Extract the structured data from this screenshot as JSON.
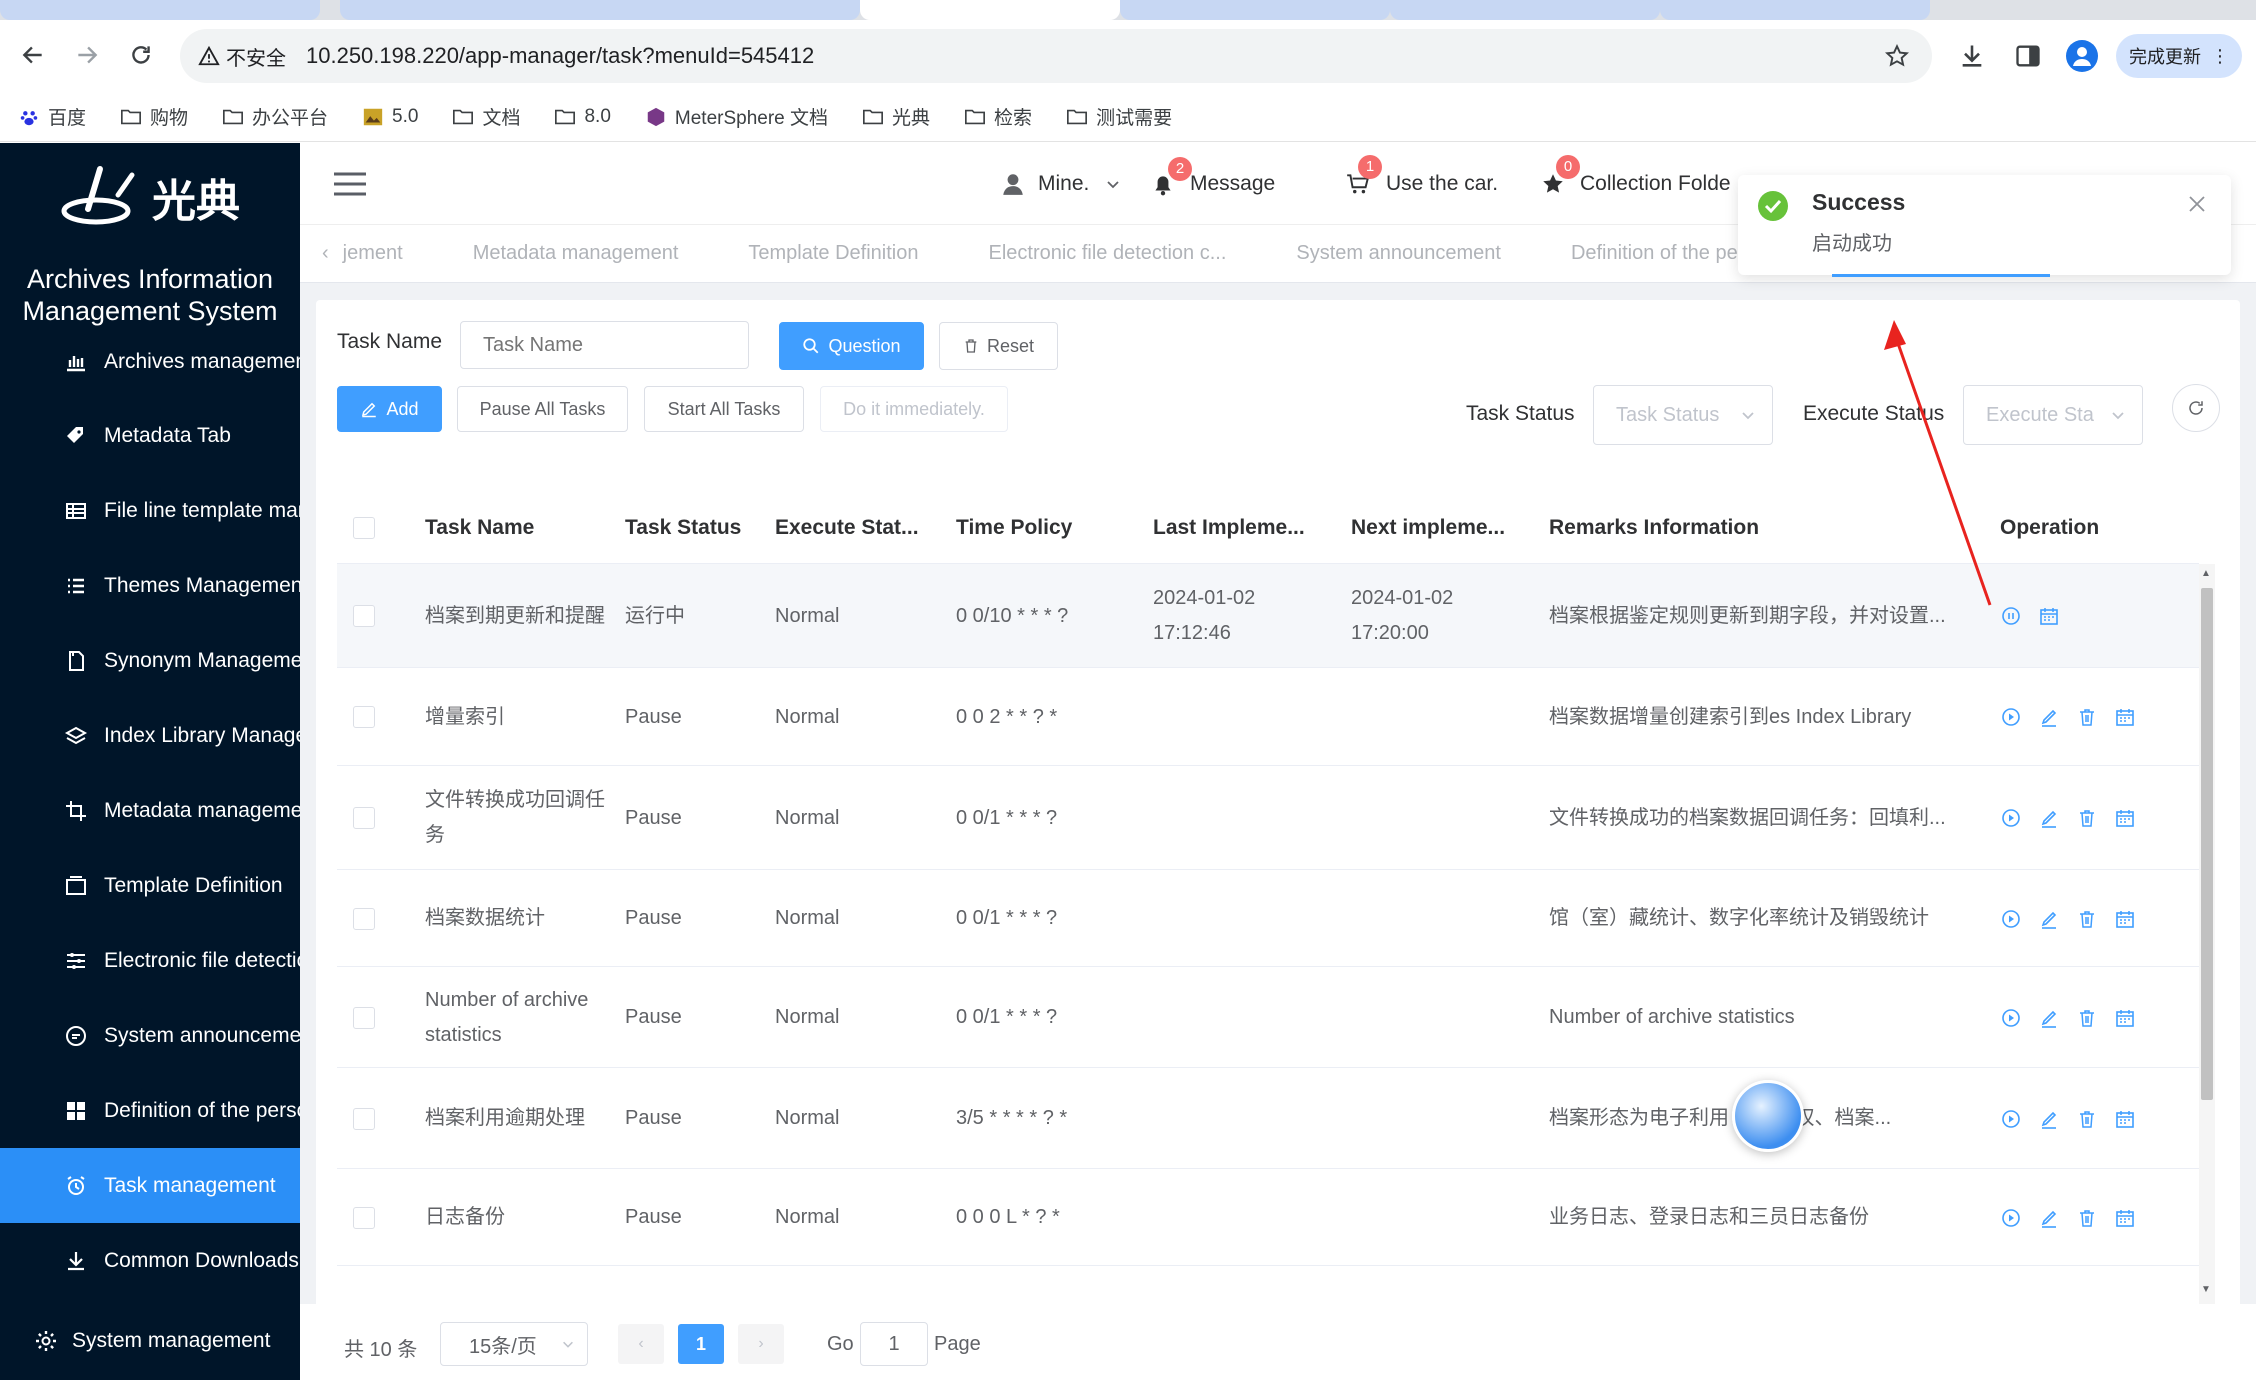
{
  "browser": {
    "security_label": "不安全",
    "url": "10.250.198.220/app-manager/task?menuId=545412",
    "update_label": "完成更新",
    "bookmarks": [
      {
        "label": "百度",
        "icon": "baidu-icon"
      },
      {
        "label": "购物",
        "icon": "folder-icon"
      },
      {
        "label": "办公平台",
        "icon": "folder-icon"
      },
      {
        "label": "5.0",
        "icon": "image-icon"
      },
      {
        "label": "文档",
        "icon": "folder-icon"
      },
      {
        "label": "8.0",
        "icon": "folder-icon"
      },
      {
        "label": "MeterSphere 文档",
        "icon": "metersphere-icon"
      },
      {
        "label": "光典",
        "icon": "folder-icon"
      },
      {
        "label": "检索",
        "icon": "folder-icon"
      },
      {
        "label": "测试需要",
        "icon": "folder-icon"
      }
    ]
  },
  "brand": {
    "logo_text": "光典",
    "system_name_line1": "Archives Information",
    "system_name_line2": "Management System"
  },
  "sidebar": {
    "items": [
      {
        "label": "Archives management",
        "icon": "chart-icon"
      },
      {
        "label": "Metadata Tab",
        "icon": "tag-icon"
      },
      {
        "label": "File line template management",
        "icon": "table-icon"
      },
      {
        "label": "Themes Management",
        "icon": "list-icon"
      },
      {
        "label": "Synonym Management",
        "icon": "document-icon"
      },
      {
        "label": "Index Library Management",
        "icon": "layers-icon"
      },
      {
        "label": "Metadata management",
        "icon": "crop-icon"
      },
      {
        "label": "Template Definition",
        "icon": "window-icon"
      },
      {
        "label": "Electronic file detection",
        "icon": "sliders-icon"
      },
      {
        "label": "System announcement",
        "icon": "chat-icon"
      },
      {
        "label": "Definition of the personal",
        "icon": "grid-icon"
      },
      {
        "label": "Task management",
        "icon": "alarm-clock-icon",
        "active": true
      },
      {
        "label": "Common Downloads",
        "icon": "download-icon"
      }
    ],
    "footer": "System management"
  },
  "header": {
    "user": "Mine.",
    "message": {
      "label": "Message",
      "count": "2"
    },
    "cart": {
      "label": "Use the car.",
      "count": "1"
    },
    "collection": {
      "label": "Collection Folde",
      "count": "0"
    }
  },
  "tags": [
    "jement",
    "Metadata management",
    "Template Definition",
    "Electronic file detection c...",
    "System announcement",
    "Definition of the perso"
  ],
  "form": {
    "task_name_label": "Task Name",
    "task_name_placeholder": "Task Name",
    "question_btn": "Question",
    "reset_btn": "Reset",
    "add_btn": "Add",
    "pause_all_btn": "Pause All Tasks",
    "start_all_btn": "Start All Tasks",
    "do_now_btn": "Do it immediately.",
    "task_status_label": "Task Status",
    "task_status_placeholder": "Task Status",
    "execute_status_label": "Execute Status",
    "execute_status_placeholder": "Execute Sta"
  },
  "table": {
    "columns": [
      "Task Name",
      "Task Status",
      "Execute Stat...",
      "Time Policy",
      "Last Impleme...",
      "Next impleme...",
      "Remarks Information",
      "Operation"
    ],
    "rows": [
      {
        "name": "档案到期更新和提醒",
        "status": "运行中",
        "exec": "Normal",
        "policy": "0 0/10 * * * ?",
        "last": "2024-01-02 17:12:46",
        "next": "2024-01-02 17:20:00",
        "remark": "档案根据鉴定规则更新到期字段，并对设置..."
      },
      {
        "name": "增量索引",
        "status": "Pause",
        "exec": "Normal",
        "policy": "0 0 2 * * ? *",
        "last": "",
        "next": "",
        "remark": "档案数据增量创建索引到es Index Library"
      },
      {
        "name": "文件转换成功回调任务",
        "status": "Pause",
        "exec": "Normal",
        "policy": "0 0/1 * * * ?",
        "last": "",
        "next": "",
        "remark": "文件转换成功的档案数据回调任务：回填利..."
      },
      {
        "name": "档案数据统计",
        "status": "Pause",
        "exec": "Normal",
        "policy": "0 0/1 * * * ?",
        "last": "",
        "next": "",
        "remark": "馆（室）藏统计、数字化率统计及销毁统计"
      },
      {
        "name": "Number of archive statistics",
        "status": "Pause",
        "exec": "Normal",
        "policy": "0 0/1 * * * ?",
        "last": "",
        "next": "",
        "remark": "Number of archive statistics"
      },
      {
        "name": "档案利用逾期处理",
        "status": "Pause",
        "exec": "Normal",
        "policy": "3/5 * * * * ? *",
        "last": "",
        "next": "",
        "remark": "档案形态为电子利用 强制收权、档案..."
      },
      {
        "name": "日志备份",
        "status": "Pause",
        "exec": "Normal",
        "policy": "0 0 0 L * ? *",
        "last": "",
        "next": "",
        "remark": "业务日志、登录日志和三员日志备份"
      }
    ]
  },
  "pagination": {
    "total": "共 10 条",
    "page_size": "15条/页",
    "current": "1",
    "go_label": "Go",
    "go_value": "1",
    "page_label": "Page"
  },
  "toast": {
    "title": "Success",
    "message": "启动成功"
  },
  "colors": {
    "primary": "#409eff",
    "sidebar": "#001529",
    "active": "#2b8ff7",
    "success": "#67c23a",
    "annotation_arrow": "#e8231f"
  }
}
